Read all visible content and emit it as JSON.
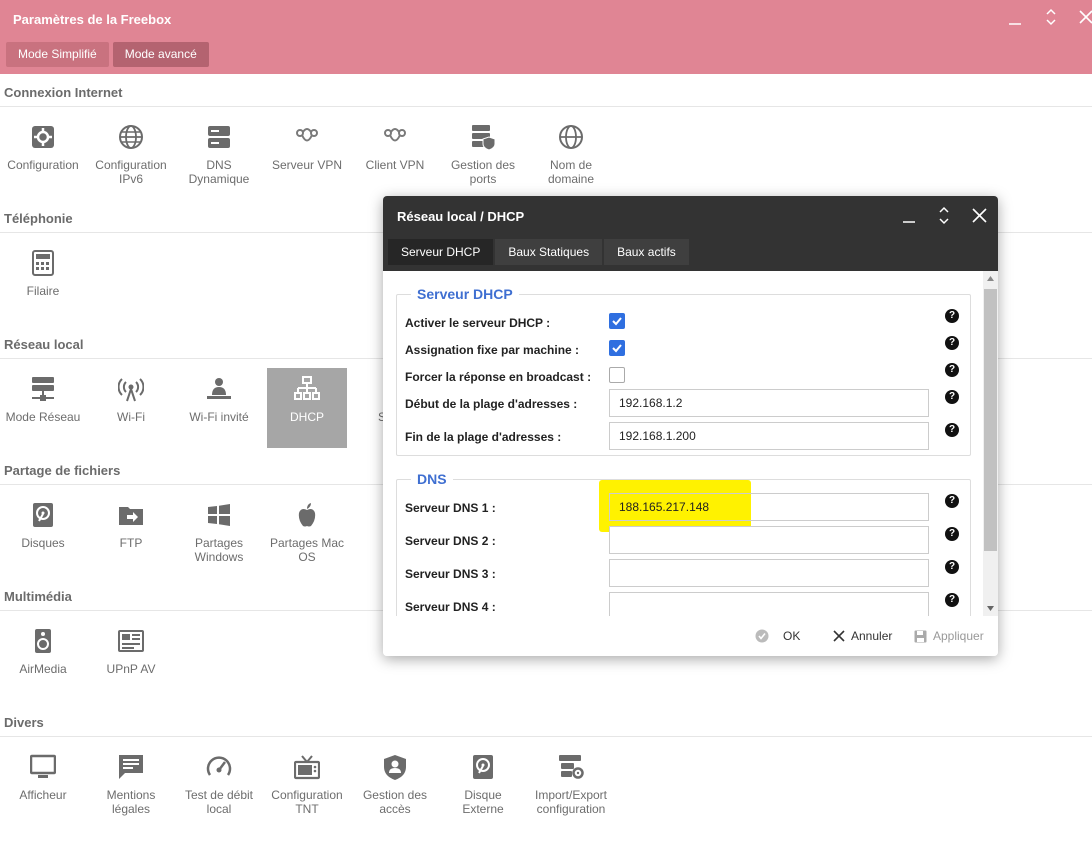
{
  "app": {
    "title": "Paramètres de la Freebox",
    "modes": [
      "Mode Simplifié",
      "Mode avancé"
    ],
    "active_mode": "Mode avancé"
  },
  "sections": [
    {
      "title": "Connexion Internet",
      "items": [
        {
          "label": "Configuration",
          "icon": "gear-icon"
        },
        {
          "label": "Configuration IPv6",
          "icon": "globe-icon"
        },
        {
          "label": "DNS Dynamique",
          "icon": "server-icon"
        },
        {
          "label": "Serveur VPN",
          "icon": "vpn-icon"
        },
        {
          "label": "Client VPN",
          "icon": "vpn-icon"
        },
        {
          "label": "Gestion des ports",
          "icon": "server-shield-icon"
        },
        {
          "label": "Nom de domaine",
          "icon": "globe-icon"
        }
      ]
    },
    {
      "title": "Téléphonie",
      "items": [
        {
          "label": "Filaire",
          "icon": "phone-keypad-icon"
        }
      ]
    },
    {
      "title": "Réseau local",
      "items": [
        {
          "label": "Mode Réseau",
          "icon": "server-network-icon"
        },
        {
          "label": "Wi-Fi",
          "icon": "wifi-icon"
        },
        {
          "label": "Wi-Fi invité",
          "icon": "guest-user-icon"
        },
        {
          "label": "DHCP",
          "icon": "network-tree-icon",
          "selected": true
        },
        {
          "label": "S",
          "icon": ""
        }
      ]
    },
    {
      "title": "Partage de fichiers",
      "items": [
        {
          "label": "Disques",
          "icon": "disk-icon"
        },
        {
          "label": "FTP",
          "icon": "folder-arrow-icon"
        },
        {
          "label": "Partages Windows",
          "icon": "windows-icon"
        },
        {
          "label": "Partages Mac OS",
          "icon": "apple-icon"
        }
      ]
    },
    {
      "title": "Multimédia",
      "items": [
        {
          "label": "AirMedia",
          "icon": "speaker-icon"
        },
        {
          "label": "UPnP AV",
          "icon": "media-panel-icon"
        }
      ]
    },
    {
      "title": "Divers",
      "items": [
        {
          "label": "Afficheur",
          "icon": "monitor-icon"
        },
        {
          "label": "Mentions légales",
          "icon": "message-icon"
        },
        {
          "label": "Test de débit local",
          "icon": "speedometer-icon"
        },
        {
          "label": "Configuration TNT",
          "icon": "tv-icon"
        },
        {
          "label": "Gestion des accès",
          "icon": "shield-user-icon"
        },
        {
          "label": "Disque Externe",
          "icon": "disk-icon"
        },
        {
          "label": "Import/Export configuration",
          "icon": "server-gear-icon"
        }
      ]
    }
  ],
  "dialog": {
    "title": "Réseau local / DHCP",
    "tabs": [
      "Serveur DHCP",
      "Baux Statiques",
      "Baux actifs"
    ],
    "active_tab": "Serveur DHCP",
    "dhcp": {
      "legend": "Serveur DHCP",
      "enable_label": "Activer le serveur DHCP :",
      "enable_checked": true,
      "fixed_label": "Assignation fixe par machine :",
      "fixed_checked": true,
      "broadcast_label": "Forcer la réponse en broadcast :",
      "broadcast_checked": false,
      "range_start_label": "Début de la plage d'adresses :",
      "range_start": "192.168.1.2",
      "range_end_label": "Fin de la plage d'adresses :",
      "range_end": "192.168.1.200"
    },
    "dns": {
      "legend": "DNS",
      "dns1_label": "Serveur DNS 1 :",
      "dns1": "188.165.217.148",
      "dns2_label": "Serveur DNS 2 :",
      "dns2": "",
      "dns3_label": "Serveur DNS 3 :",
      "dns3": "",
      "dns4_label": "Serveur DNS 4 :",
      "dns4": ""
    },
    "help_glyph": "?",
    "footer": {
      "ok": "OK",
      "cancel": "Annuler",
      "apply": "Appliquer"
    }
  },
  "colors": {
    "header": "#e08594",
    "accent": "#2f6fe0",
    "highlight": "#fff200",
    "dialog_header": "#333333"
  }
}
